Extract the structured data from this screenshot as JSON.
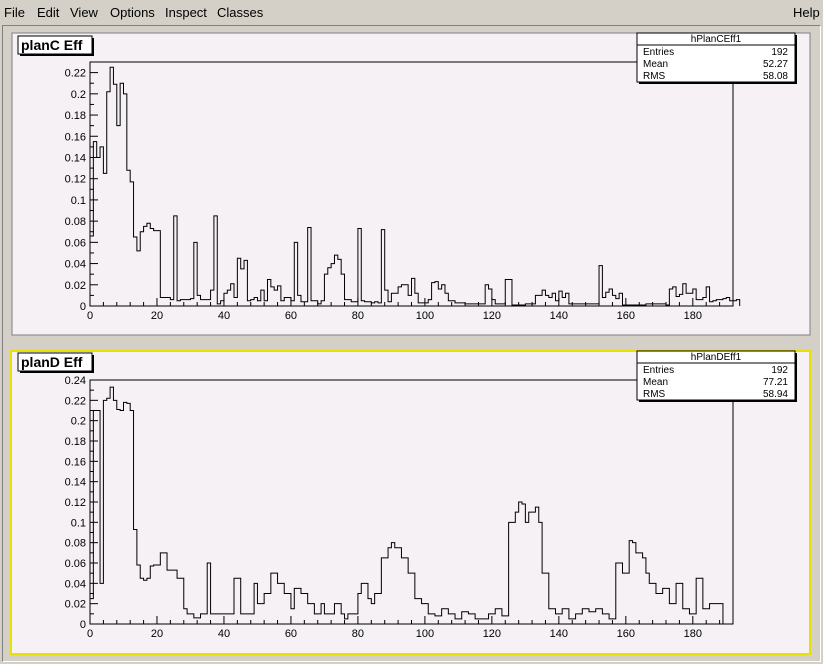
{
  "menu": {
    "file": "File",
    "edit": "Edit",
    "view": "View",
    "options": "Options",
    "inspect": "Inspect",
    "classes": "Classes",
    "help": "Help"
  },
  "colors": {
    "pad_bg": "#f5f1f4",
    "active_pad_border": "#e8e000",
    "line": "#000000"
  },
  "chart_data": [
    {
      "type": "histogram",
      "title": "planC Eff",
      "stats": {
        "name": "hPlanCEff1",
        "entries_label": "Entries",
        "entries": "192",
        "mean_label": "Mean",
        "mean": "52.27",
        "rms_label": "RMS",
        "rms": "58.08"
      },
      "xlim": [
        0,
        192
      ],
      "ylim": [
        0,
        0.23
      ],
      "xticks": [
        "0",
        "20",
        "40",
        "60",
        "80",
        "100",
        "120",
        "140",
        "160",
        "180"
      ],
      "yticks": [
        "0",
        "0.02",
        "0.04",
        "0.06",
        "0.08",
        "0.1",
        "0.12",
        "0.14",
        "0.16",
        "0.18",
        "0.2",
        "0.22"
      ],
      "bin_width": 1,
      "values": [
        0.066,
        0.155,
        0.14,
        0.15,
        0.125,
        0.202,
        0.225,
        0.209,
        0.17,
        0.21,
        0.2,
        0.128,
        0.117,
        0.065,
        0.052,
        0.07,
        0.075,
        0.078,
        0.073,
        0.071,
        0.071,
        0.008,
        0.008,
        0.008,
        0.006,
        0.085,
        0.005,
        0.006,
        0.006,
        0.006,
        0.007,
        0.06,
        0.01,
        0.006,
        0.006,
        0.006,
        0.015,
        0.085,
        0.002,
        0.005,
        0.012,
        0.015,
        0.021,
        0.008,
        0.045,
        0.035,
        0.043,
        0.005,
        0.006,
        0.008,
        0.005,
        0.015,
        0.005,
        0.025,
        0.018,
        0.015,
        0.019,
        0.005,
        0.008,
        0.008,
        0.005,
        0.06,
        0.01,
        0.004,
        0.004,
        0.074,
        0.005,
        0.005,
        0.002,
        0.005,
        0.03,
        0.036,
        0.04,
        0.048,
        0.044,
        0.03,
        0.006,
        0.006,
        0.004,
        0.004,
        0.073,
        0.005,
        0.004,
        0.004,
        0.003,
        0.004,
        0.003,
        0.072,
        0.015,
        0.004,
        0.012,
        0.012,
        0.018,
        0.02,
        0.02,
        0.01,
        0.026,
        0.012,
        0.003,
        0.003,
        0.003,
        0.006,
        0.022,
        0.023,
        0.016,
        0.02,
        0.012,
        0.005,
        0.005,
        0.003,
        0.003,
        0.003,
        0.002,
        0.002,
        0.002,
        0.002,
        0.002,
        0.002,
        0.02,
        0.016,
        0.006,
        0.002,
        0.002,
        0.002,
        0.025,
        0.025,
        0.001,
        0.001,
        0.001,
        0.001,
        0.002,
        0.002,
        0.002,
        0.01,
        0.01,
        0.015,
        0.01,
        0.008,
        0.012,
        0.005,
        0.014,
        0.008,
        0.012,
        0.002,
        0.002,
        0.002,
        0.002,
        0.002,
        0.002,
        0.002,
        0.002,
        0.002,
        0.038,
        0.008,
        0.013,
        0.016,
        0.01,
        0.007,
        0.012,
        0.001,
        0.001,
        0.001,
        0.001,
        0.001,
        0.001,
        0.001,
        0.002,
        0.002,
        0.002,
        0.002,
        0.002,
        0.002,
        0.001,
        0.016,
        0.018,
        0.009,
        0.011,
        0.021,
        0.012,
        0.012,
        0.016,
        0.006,
        0.006,
        0.008,
        0.018,
        0.004,
        0.005,
        0.006,
        0.006,
        0.007,
        0.008,
        0.005,
        0.005,
        0.006
      ]
    },
    {
      "type": "histogram",
      "title": "planD Eff",
      "stats": {
        "name": "hPlanDEff1",
        "entries_label": "Entries",
        "entries": "192",
        "mean_label": "Mean",
        "mean": "77.21",
        "rms_label": "RMS",
        "rms": "58.94"
      },
      "xlim": [
        0,
        192
      ],
      "ylim": [
        0,
        0.24
      ],
      "xticks": [
        "0",
        "20",
        "40",
        "60",
        "80",
        "100",
        "120",
        "140",
        "160",
        "180"
      ],
      "yticks": [
        "0",
        "0.02",
        "0.04",
        "0.06",
        "0.08",
        "0.1",
        "0.12",
        "0.14",
        "0.16",
        "0.18",
        "0.2",
        "0.22",
        "0.24"
      ],
      "bin_width": 1,
      "values": [
        0.025,
        0.21,
        0.21,
        0.04,
        0.22,
        0.222,
        0.233,
        0.22,
        0.211,
        0.21,
        0.218,
        0.217,
        0.21,
        0.093,
        0.058,
        0.045,
        0.043,
        0.045,
        0.057,
        0.058,
        0.058,
        0.07,
        0.07,
        0.053,
        0.053,
        0.053,
        0.045,
        0.045,
        0.015,
        0.01,
        0.01,
        0.006,
        0.006,
        0.01,
        0.01,
        0.06,
        0.01,
        0.01,
        0.01,
        0.01,
        0.01,
        0.01,
        0.01,
        0.045,
        0.045,
        0.01,
        0.01,
        0.01,
        0.01,
        0.04,
        0.02,
        0.02,
        0.03,
        0.03,
        0.05,
        0.05,
        0.04,
        0.04,
        0.03,
        0.03,
        0.015,
        0.035,
        0.035,
        0.03,
        0.03,
        0.02,
        0.02,
        0.01,
        0.01,
        0.02,
        0.01,
        0.01,
        0.01,
        0.02,
        0.02,
        0.01,
        0.005,
        0.01,
        0.01,
        0.01,
        0.03,
        0.04,
        0.04,
        0.025,
        0.02,
        0.03,
        0.03,
        0.065,
        0.065,
        0.075,
        0.08,
        0.075,
        0.075,
        0.065,
        0.065,
        0.05,
        0.05,
        0.025,
        0.025,
        0.02,
        0.02,
        0.01,
        0.01,
        0.008,
        0.008,
        0.015,
        0.015,
        0.01,
        0.01,
        0.005,
        0.005,
        0.012,
        0.012,
        0.01,
        0.01,
        0.005,
        0.005,
        0.005,
        0.005,
        0.01,
        0.01,
        0.015,
        0.015,
        0.008,
        0.008,
        0.1,
        0.1,
        0.11,
        0.12,
        0.118,
        0.1,
        0.11,
        0.11,
        0.115,
        0.1,
        0.05,
        0.05,
        0.015,
        0.015,
        0.01,
        0.01,
        0.015,
        0.015,
        0.005,
        0.005,
        0.01,
        0.01,
        0.015,
        0.015,
        0.012,
        0.012,
        0.015,
        0.015,
        0.01,
        0.01,
        0.005,
        0.005,
        0.06,
        0.06,
        0.05,
        0.05,
        0.082,
        0.08,
        0.07,
        0.07,
        0.065,
        0.05,
        0.04,
        0.04,
        0.03,
        0.03,
        0.035,
        0.035,
        0.02,
        0.02,
        0.04,
        0.04,
        0.015,
        0.015,
        0.01,
        0.01,
        0.045,
        0.045,
        0.015,
        0.015,
        0.02,
        0.02,
        0.02,
        0.02
      ]
    }
  ]
}
